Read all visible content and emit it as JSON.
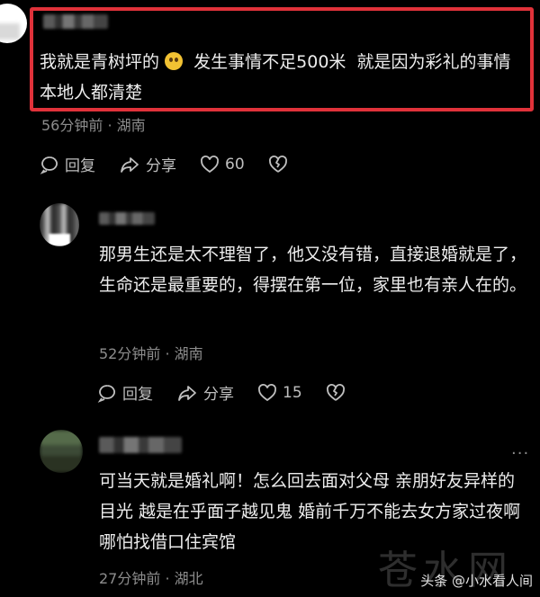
{
  "comments": [
    {
      "text": "我就是青树坪的",
      "text_after_emoji": "  发生事情不足500米  就是因为彩礼的事情  本地人都清楚",
      "emoji": "fearful-face-emoji",
      "meta": "56分钟前 · 湖南",
      "actions": {
        "reply": "回复",
        "share": "分享",
        "likes": "60"
      }
    },
    {
      "text": "那男生还是太不理智了，他又没有错，直接退婚就是了，生命还是最重要的，得摆在第一位，家里也有亲人在的。",
      "meta": "52分钟前 · 湖南",
      "actions": {
        "reply": "回复",
        "share": "分享",
        "likes": "15"
      }
    },
    {
      "text": "可当天就是婚礼啊！怎么回去面对父母 亲朋好友异样的目光 越是在乎面子越见鬼 婚前千万不能去女方家过夜啊 哪怕找借口住宾馆",
      "meta": "27分钟前 · 湖北",
      "more": "···"
    }
  ],
  "watermark": {
    "text": "头条 @小水看人间",
    "logo_text": "苍水网"
  },
  "colors": {
    "highlight": "#e0323a",
    "background": "#000000",
    "text": "#ededed",
    "meta": "#8d8d8d"
  }
}
